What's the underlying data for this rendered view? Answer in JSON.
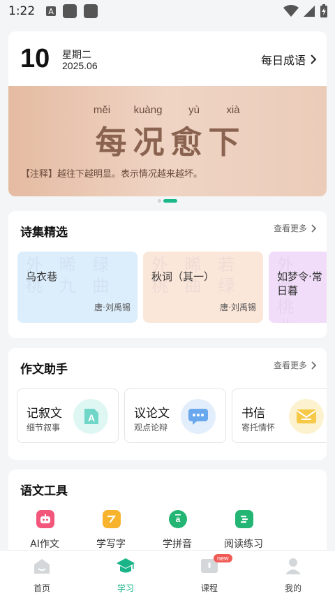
{
  "status_bar": {
    "time": "1:22"
  },
  "idiom_card": {
    "day": "10",
    "weekday": "星期二",
    "year_month": "2025.06",
    "link_label": "每日成语",
    "pinyin": [
      "měi",
      "kuàng",
      "yù",
      "xià"
    ],
    "chars": [
      "每",
      "况",
      "愈",
      "下"
    ],
    "note": "【注释】越往下越明显。表示情况越来越坏。"
  },
  "poems": {
    "title": "诗集精选",
    "more": "查看更多",
    "items": [
      {
        "title": "乌衣巷",
        "author": "唐·刘禹锡",
        "bg": "#dcedfb"
      },
      {
        "title": "秋词（其一）",
        "author": "唐·刘禹锡",
        "bg": "#fbe6da"
      },
      {
        "title": "如梦令·常记溪亭日暮",
        "title_visible": "如梦令·常\n日暮",
        "author": "",
        "bg": "#f1ddf9"
      }
    ]
  },
  "essay": {
    "title": "作文助手",
    "more": "查看更多",
    "items": [
      {
        "name": "记叙文",
        "desc": "细节叙事",
        "icon": "document-a-icon",
        "color": "#6fd6c8"
      },
      {
        "name": "议论文",
        "desc": "观点论辩",
        "icon": "chat-bubble-icon",
        "color": "#6aa8ee"
      },
      {
        "name": "书信",
        "desc": "寄托情怀",
        "icon": "envelope-icon",
        "color": "#f6c949"
      }
    ]
  },
  "tools": {
    "title": "语文工具",
    "items": [
      {
        "label": "AI作文",
        "icon": "robot-icon",
        "color": "#f2567a"
      },
      {
        "label": "学写字",
        "icon": "pen-icon",
        "color": "#f7b32b"
      },
      {
        "label": "学拼音",
        "icon": "pinyin-icon",
        "color": "#22b573"
      },
      {
        "label": "阅读练习",
        "icon": "book-icon",
        "color": "#22b573"
      }
    ]
  },
  "nav": {
    "items": [
      {
        "label": "首页",
        "icon": "home-icon",
        "active": false
      },
      {
        "label": "学习",
        "icon": "graduation-cap-icon",
        "active": true
      },
      {
        "label": "课程",
        "icon": "course-icon",
        "active": false,
        "badge": "new"
      },
      {
        "label": "我的",
        "icon": "profile-icon",
        "active": false
      }
    ]
  }
}
